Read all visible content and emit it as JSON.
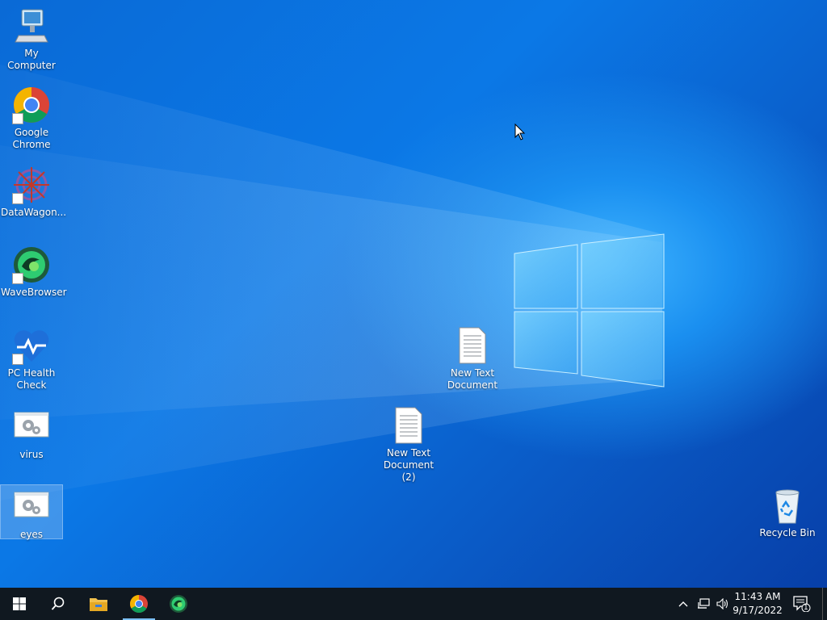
{
  "desktop_icons": [
    {
      "label": "My Computer"
    },
    {
      "label": "Google Chrome"
    },
    {
      "label": "DataWagon..."
    },
    {
      "label": "WaveBrowser"
    },
    {
      "label": "PC Health Check"
    },
    {
      "label": "virus"
    },
    {
      "label": "eyes"
    },
    {
      "label": "New Text Document"
    },
    {
      "label": "New Text Document (2)"
    },
    {
      "label": "Recycle Bin"
    }
  ],
  "taskbar": {
    "pinned": [
      "start-icon",
      "search-icon",
      "file-explorer-icon",
      "chrome-icon",
      "wavebrowser-icon"
    ],
    "clock_time": "11:43 AM",
    "clock_date": "9/17/2022",
    "notification_count": "1"
  },
  "colors": {
    "taskbar": "#101820",
    "desktop_accent": "#0b78e6"
  }
}
